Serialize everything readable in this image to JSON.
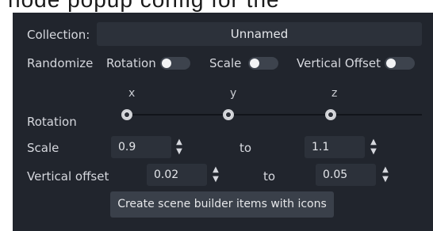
{
  "top_strip_text": "node popup config for the",
  "collection": {
    "label": "Collection:",
    "value": "Unnamed"
  },
  "randomize": {
    "label": "Randomize",
    "rotation_label": "Rotation",
    "scale_label": "Scale",
    "vertical_offset_label": "Vertical Offset",
    "rotation_enabled": false,
    "scale_enabled": false,
    "vertical_offset_enabled": false
  },
  "rotation": {
    "label": "Rotation",
    "axes": [
      "x",
      "y",
      "z"
    ],
    "values_fraction": [
      0.0,
      0.0,
      0.0
    ]
  },
  "scale": {
    "label": "Scale",
    "min": "0.9",
    "to_label": "to",
    "max": "1.1"
  },
  "vertical_offset": {
    "label": "Vertical offset",
    "min": "0.02",
    "to_label": "to",
    "max": "0.05"
  },
  "create_button_label": "Create scene builder items with icons",
  "icons": {
    "spin_up": "▲",
    "spin_down": "▼",
    "spinner": "spinner-arrows-icon"
  },
  "colors": {
    "panel": "#21252d",
    "field": "#2c313a",
    "button": "#3a404a",
    "toggle_off": "#3d434d"
  }
}
